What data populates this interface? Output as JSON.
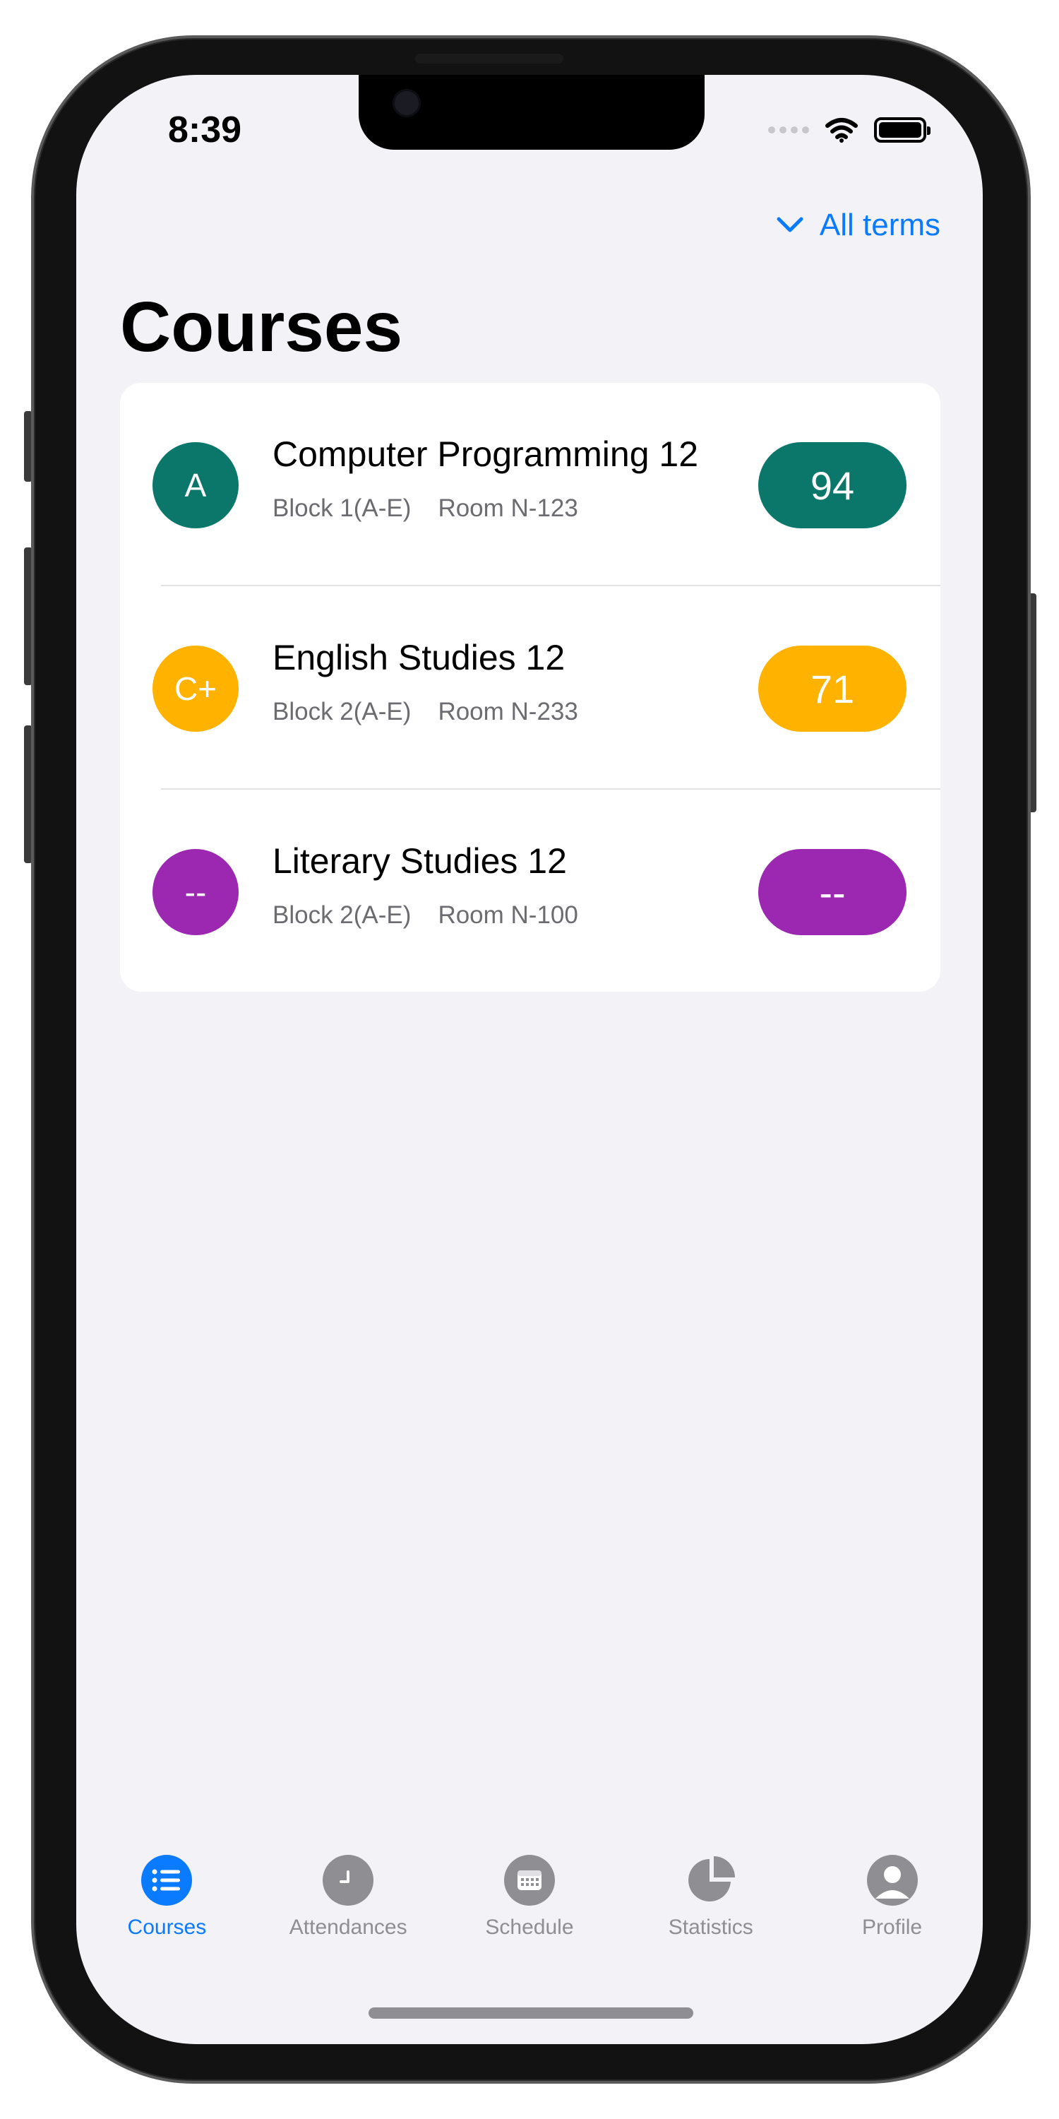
{
  "status_bar": {
    "time": "8:39"
  },
  "header": {
    "terms_label": "All terms",
    "title": "Courses"
  },
  "courses": [
    {
      "grade_letter": "A",
      "name": "Computer Programming 12",
      "block": "Block 1(A-E)",
      "room": "Room N-123",
      "score": "94",
      "color": "#0b776a"
    },
    {
      "grade_letter": "C+",
      "name": "English Studies 12",
      "block": "Block 2(A-E)",
      "room": "Room N-233",
      "score": "71",
      "color": "#ffb300"
    },
    {
      "grade_letter": "--",
      "name": "Literary Studies 12",
      "block": "Block 2(A-E)",
      "room": "Room N-100",
      "score": "--",
      "color": "#9c27b0"
    }
  ],
  "tabs": [
    {
      "label": "Courses",
      "icon": "list-icon",
      "active": true
    },
    {
      "label": "Attendances",
      "icon": "clock-icon",
      "active": false
    },
    {
      "label": "Schedule",
      "icon": "calendar-icon",
      "active": false
    },
    {
      "label": "Statistics",
      "icon": "pie-chart-icon",
      "active": false
    },
    {
      "label": "Profile",
      "icon": "person-icon",
      "active": false
    }
  ],
  "colors": {
    "accent": "#0a7aff",
    "background": "#f2f2f7",
    "inactive": "#8e8e93"
  }
}
